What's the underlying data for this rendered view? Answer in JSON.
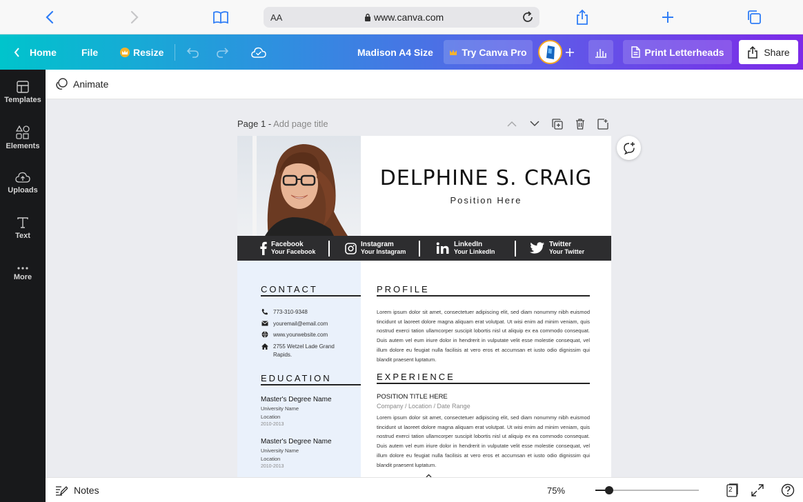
{
  "browser": {
    "text_size_label": "AA",
    "url": "www.canva.com"
  },
  "toolbar": {
    "home_label": "Home",
    "file_label": "File",
    "resize_label": "Resize",
    "doc_title": "Madison A4 Size",
    "pro_label": "Try Canva Pro",
    "print_label": "Print Letterheads",
    "share_label": "Share",
    "brand_color": "#7d2ae8"
  },
  "sidebar": {
    "items": [
      {
        "label": "Templates",
        "icon": "templates-icon"
      },
      {
        "label": "Elements",
        "icon": "elements-icon"
      },
      {
        "label": "Uploads",
        "icon": "uploads-icon"
      },
      {
        "label": "Text",
        "icon": "text-icon"
      },
      {
        "label": "More",
        "icon": "more-icon"
      }
    ]
  },
  "animate_label": "Animate",
  "page": {
    "label": "Page 1 -",
    "add_title": "Add page title"
  },
  "resume": {
    "name": "DELPHINE S. CRAIG",
    "position": "Position Here",
    "social": [
      {
        "network": "Facebook",
        "handle": "Your Facebook"
      },
      {
        "network": "Instagram",
        "handle": "Your Instagram"
      },
      {
        "network": "LinkedIn",
        "handle": "Your LinkedIn"
      },
      {
        "network": "Twitter",
        "handle": "Your Twitter"
      }
    ],
    "contact_title": "CONTACT",
    "contact": {
      "phone": "773-310-9348",
      "email": "youremail@email.com",
      "website": "www.yourwebsite.com",
      "address": "2755 Wetzel Lade Grand Rapids."
    },
    "education_title": "EDUCATION",
    "education": [
      {
        "degree": "Master's Degree Name",
        "school": "University Name",
        "location": "Location",
        "years": "2010-2013"
      },
      {
        "degree": "Master's Degree Name",
        "school": "University Name",
        "location": "Location",
        "years": "2010-2013"
      }
    ],
    "profile_title": "PROFILE",
    "profile_text": "Lorem ipsum dolor sit amet, consectetuer adipiscing elit, sed diam nonummy nibh euismod tincidunt ut laoreet dolore magna aliquam erat volutpat. Ut wisi enim ad minim veniam, quis nostrud exerci tation ullamcorper suscipit lobortis nisl ut aliquip ex ea commodo consequat. Duis autem vel eum iriure dolor in hendrerit in vulputate velit esse molestie consequat, vel illum dolore eu feugiat nulla facilisis at vero eros et accumsan et iusto odio dignissim qui blandit praesent luptatum.",
    "experience_title": "EXPERIENCE",
    "experience": {
      "position": "POSITION TITLE HERE",
      "company": "Company / Location / Date Range",
      "text": "Lorem ipsum dolor sit amet, consectetuer adipiscing elit, sed diam nonummy nibh euismod tincidunt ut laoreet dolore magna aliquam erat volutpat. Ut wisi enim ad minim veniam, quis nostrud exerci tation ullamcorper suscipit lobortis nisl ut aliquip ex ea commodo consequat. Duis autem vel eum iriure dolor in hendrerit in vulputate velit esse molestie consequat, vel illum dolore eu feugiat nulla facilisis at vero eros et accumsan et iusto odio dignissim qui blandit praesent luptatum."
    }
  },
  "bottom": {
    "notes_label": "Notes",
    "zoom": "75%",
    "zoom_fraction": 0.13,
    "page_count": "2"
  }
}
